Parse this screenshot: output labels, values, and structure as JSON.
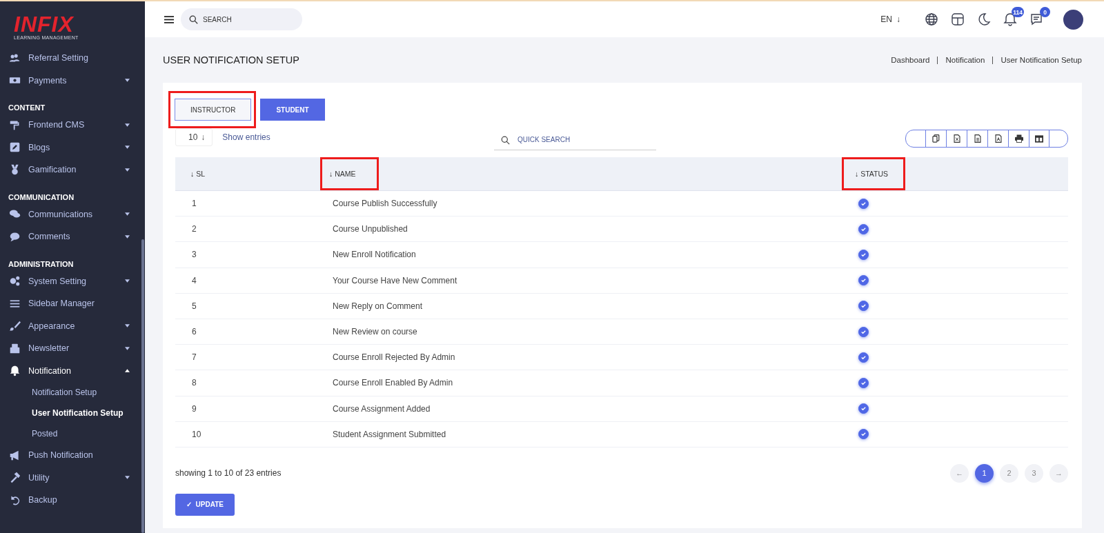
{
  "logo": {
    "name": "INFIX",
    "tagline": "LEARNING MANAGEMENT"
  },
  "sidebar": {
    "items": [
      {
        "kind": "item",
        "label": "Referral Setting",
        "selected": false
      },
      {
        "kind": "item",
        "label": "Payments",
        "expanded": false,
        "selected": false
      },
      {
        "kind": "heading",
        "label": "CONTENT"
      },
      {
        "kind": "item",
        "label": "Frontend CMS",
        "expanded": false,
        "selected": false
      },
      {
        "kind": "item",
        "label": "Blogs",
        "expanded": false,
        "selected": false
      },
      {
        "kind": "item",
        "label": "Gamification",
        "expanded": false,
        "selected": false
      },
      {
        "kind": "heading",
        "label": "COMMUNICATION"
      },
      {
        "kind": "item",
        "label": "Communications",
        "expanded": false,
        "selected": false
      },
      {
        "kind": "item",
        "label": "Comments",
        "expanded": false,
        "selected": false
      },
      {
        "kind": "heading",
        "label": "ADMINISTRATION"
      },
      {
        "kind": "item",
        "label": "System Setting",
        "expanded": false,
        "selected": false
      },
      {
        "kind": "item",
        "label": "Sidebar Manager",
        "selected": false
      },
      {
        "kind": "item",
        "label": "Appearance",
        "expanded": false,
        "selected": false
      },
      {
        "kind": "item",
        "label": "Newsletter",
        "expanded": false,
        "selected": false
      },
      {
        "kind": "item",
        "label": "Notification",
        "expanded": true,
        "selected": true
      },
      {
        "kind": "subitem",
        "label": "Notification Setup",
        "selected": false
      },
      {
        "kind": "subitem",
        "label": "User Notification Setup",
        "selected": true
      },
      {
        "kind": "subitem",
        "label": "Posted",
        "selected": false
      },
      {
        "kind": "item",
        "label": "Push Notification",
        "selected": false
      },
      {
        "kind": "item",
        "label": "Utility",
        "expanded": false,
        "selected": false
      },
      {
        "kind": "item",
        "label": "Backup",
        "selected": false
      }
    ]
  },
  "topbar": {
    "search": {
      "placeholder": "SEARCH"
    },
    "language": "EN",
    "language_arrow": "↓",
    "notifications_badge": "114",
    "messages_badge": "0"
  },
  "page": {
    "title": "USER NOTIFICATION SETUP",
    "breadcrumb": [
      "Dashboard",
      "Notification",
      "User Notification Setup"
    ]
  },
  "tabs": [
    {
      "label": "INSTRUCTOR",
      "selected": false,
      "highlighted": true
    },
    {
      "label": "STUDENT",
      "selected": true,
      "highlighted": false
    }
  ],
  "entries": {
    "value": "10",
    "arrow": "↓",
    "label": "Show entries"
  },
  "quick_search": {
    "placeholder": "QUICK SEARCH"
  },
  "table": {
    "columns": [
      {
        "label": "SL",
        "arrow": "↓",
        "highlighted": false
      },
      {
        "label": "NAME",
        "arrow": "↓",
        "highlighted": true
      },
      {
        "label": "STATUS",
        "arrow": "↓",
        "highlighted": true
      }
    ],
    "rows": [
      {
        "sl": "1",
        "name": "Course Publish Successfully",
        "checked": true
      },
      {
        "sl": "2",
        "name": "Course Unpublished",
        "checked": true
      },
      {
        "sl": "3",
        "name": "New Enroll Notification",
        "checked": true
      },
      {
        "sl": "4",
        "name": "Your Course Have New Comment",
        "checked": true
      },
      {
        "sl": "5",
        "name": "New Reply on Comment",
        "checked": true
      },
      {
        "sl": "6",
        "name": "New Review on course",
        "checked": true
      },
      {
        "sl": "7",
        "name": "Course Enroll Rejected By Admin",
        "checked": true
      },
      {
        "sl": "8",
        "name": "Course Enroll Enabled By Admin",
        "checked": true
      },
      {
        "sl": "9",
        "name": "Course Assignment Added",
        "checked": true
      },
      {
        "sl": "10",
        "name": "Student Assignment Submitted",
        "checked": true
      }
    ]
  },
  "summary": "showing 1 to 10 of 23 entries",
  "pagination": {
    "prev": "←",
    "next": "→",
    "pages": [
      {
        "label": "1",
        "selected": true
      },
      {
        "label": "2",
        "selected": false
      },
      {
        "label": "3",
        "selected": false
      }
    ]
  },
  "update_button": {
    "icon": "✓",
    "label": "UPDATE"
  }
}
